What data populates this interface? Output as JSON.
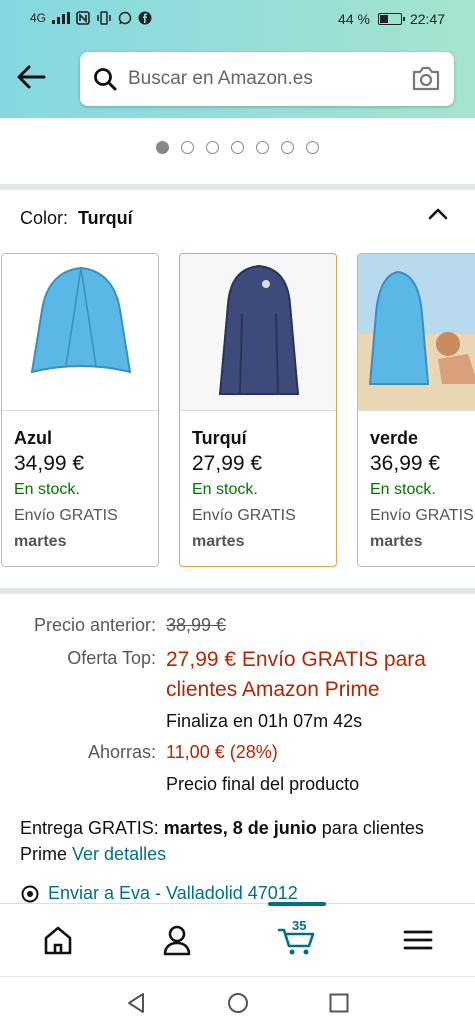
{
  "status_bar": {
    "network": "4G",
    "battery_percent": "44 %",
    "battery_level": 0.44,
    "time": "22:47"
  },
  "header": {
    "search_placeholder": "Buscar en Amazon.es"
  },
  "carousel": {
    "total": 7,
    "active": 0
  },
  "color_selector": {
    "label": "Color:",
    "selected": "Turquí"
  },
  "variants": [
    {
      "name": "Azul",
      "price": "34,99 €",
      "stock": "En stock.",
      "shipping": "Envío GRATIS",
      "day": "martes",
      "tent_color": "#5ab7e6",
      "selected": false
    },
    {
      "name": "Turquí",
      "price": "27,99 €",
      "stock": "En stock.",
      "shipping": "Envío GRATIS",
      "day": "martes",
      "tent_color": "#3d4a7a",
      "selected": true
    },
    {
      "name": "verde",
      "price": "36,99 €",
      "stock": "En stock.",
      "shipping": "Envío GRATIS",
      "day": "martes",
      "tent_color": "#5ab7e6",
      "selected": false
    }
  ],
  "pricing": {
    "previous_label": "Precio anterior:",
    "previous_value": "38,99 €",
    "deal_label": "Oferta Top:",
    "deal_text": "27,99 € Envío GRATIS para clientes Amazon Prime",
    "ends_text": "Finaliza en 01h 07m 42s",
    "savings_label": "Ahorras:",
    "savings_value": "11,00 € (28%)",
    "final_text": "Precio final del producto"
  },
  "delivery": {
    "prefix": "Entrega GRATIS:",
    "date": "martes, 8 de junio",
    "suffix": "para clientes Prime",
    "link": "Ver detalles"
  },
  "address": {
    "text": "Enviar a Eva - Valladolid 47012"
  },
  "bottom_nav": {
    "cart_count": "35"
  },
  "colors": {
    "link": "#007185",
    "price_red": "#b12704",
    "stock_green": "#007600",
    "selected_border": "#e3a34b"
  }
}
